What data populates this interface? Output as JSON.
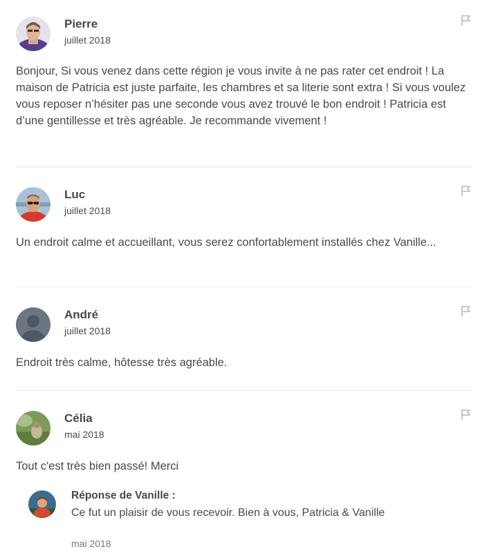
{
  "reviews": [
    {
      "name": "Pierre",
      "date": "juillet 2018",
      "text": "Bonjour, Si vous venez dans cette région je vous invite à ne pas rater cet endroit ! La maison de Patricia est juste parfaite, les chambres et sa literie sont extra ! Si vous voulez vous reposer n’hésiter pas une seconde vous avez trouvé le bon endroit ! Patricia est d’une gentillesse et très agréable. Je recommande vivement !"
    },
    {
      "name": "Luc",
      "date": "juillet 2018",
      "text": "Un endroit calme et accueillant, vous serez confortablement installés chez Vanille..."
    },
    {
      "name": "André",
      "date": "juillet 2018",
      "text": "Endroit très calme, hôtesse très agréable."
    },
    {
      "name": "Célia",
      "date": "mai 2018",
      "text": "Tout c'est très bien passé! Merci",
      "response": {
        "title": "Réponse de Vanille :",
        "text": "Ce fut un plaisir de vous recevoir. Bien à vous, Patricia & Vanille",
        "date": "mai 2018"
      }
    }
  ],
  "icons": {
    "flag": "flag-icon",
    "avatar_default": "default-user-icon"
  },
  "colors": {
    "text": "#484848",
    "muted": "#767676",
    "divider": "#ebebeb"
  }
}
